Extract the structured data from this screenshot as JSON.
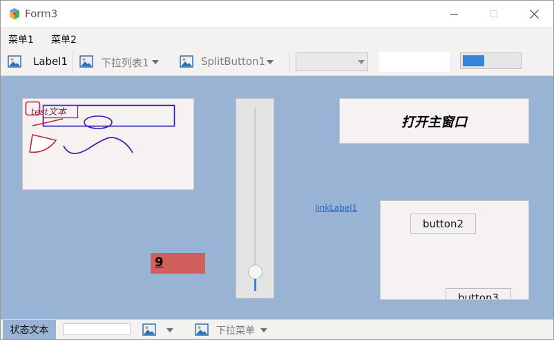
{
  "window": {
    "title": "Form3"
  },
  "menu": {
    "items": [
      "菜单1",
      "菜单2"
    ]
  },
  "toolbar": {
    "label1": "Label1",
    "dropdown1": "下拉列表1",
    "split_button1": "SplitButton1",
    "combo_value": "",
    "textbox_value": "",
    "progress_fraction": 0.38
  },
  "canvas": {
    "sample_text": "test文本"
  },
  "trackbar": {
    "value_fraction": 0.08
  },
  "main": {
    "open_main_button": "打开主窗口",
    "link_label": "linkLabel1",
    "button2": "button2",
    "button3": "button3",
    "number_value": "9"
  },
  "status": {
    "status_text": "状态文本",
    "input_value": "",
    "dropdown": "下拉菜单"
  },
  "colors": {
    "client_bg": "#98b3d3",
    "accent": "#3483dd",
    "number_box": "#d15f5c",
    "link": "#2466c8"
  },
  "icons": [
    "app-icon",
    "image-icon",
    "chevron-down-icon",
    "minimize-icon",
    "maximize-icon",
    "close-icon"
  ]
}
